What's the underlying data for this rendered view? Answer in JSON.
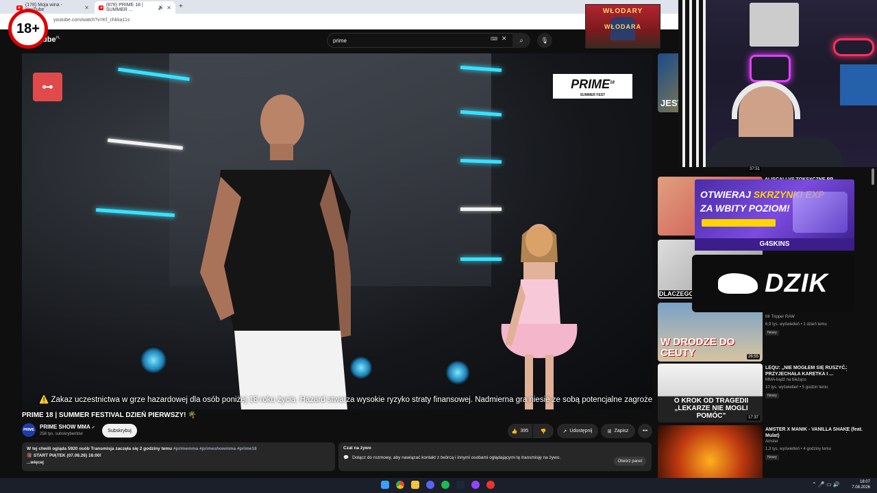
{
  "browser": {
    "tabs": [
      {
        "label": "(178) Moja wina - YouTube"
      },
      {
        "label": "(878) PRIME 18 | SUMMER ..."
      }
    ],
    "new_tab": "+",
    "url": "youtube.com/watch?v=Kf_chkka11s"
  },
  "overlay": {
    "age_badge": "18+",
    "banner_line1": "WŁODARY",
    "banner_line2": "WŁODARA"
  },
  "youtube": {
    "logo_suffix": "ube",
    "logo_region": "PL",
    "search_value": "prime"
  },
  "video": {
    "logo_text": "PRIME",
    "logo_sup": "18",
    "logo_sub": "SUMMER FEST",
    "warning": "⚠️ Zakaz uczestnictwa w grze hazardowej dla osób poniżej 18 roku życia. Hazard stwarza wysokie ryzyko straty finansowej. Nadmierna gra niesie ze sobą potencjalne zagrożenie dla zdrowia ⚠️",
    "title": "PRIME 18 | SUMMER FESTIVAL DZIEŃ PIERWSZY! 🌴",
    "channel": "PRIME SHOW MMA",
    "subscribers": "258 tys. subskrybentów",
    "subscribe_label": "Subskrybuj",
    "likes": "395",
    "share_label": "Udostępnij",
    "save_label": "Zapisz",
    "more_label": "•••"
  },
  "description": {
    "line1": "W tej chwili ogląda 5920 osób  Transmisja zaczęła się 2 godziny temu",
    "tags": "#primemma #primeshowmma #prime18",
    "line2": "🔞 START PIĄTEK (07.08.26) 16:00!",
    "more": "...więcej"
  },
  "chat": {
    "title": "Czat na żywo",
    "text": "Dołącz do rozmowy, aby nawiązać kontakt z twórcą i innymi osobami oglądającymi tę transmisję na żywo.",
    "button": "Otwórz panel"
  },
  "recommendations": [
    {
      "title": "",
      "channel": "",
      "meta": "",
      "duration": "",
      "thumb": "JEST GORZEJ"
    },
    {
      "title": "ALISCALI VS TOKSYCZNE RP",
      "channel": "",
      "meta": "",
      "duration": "37:51",
      "thumb": ""
    },
    {
      "title": "",
      "channel": "",
      "meta": "",
      "duration": "",
      "thumb": "DLACZEGO"
    },
    {
      "title": "",
      "channel": "Mr Tripper RAW",
      "meta": "6,9 tys. wyświetleń • 1 dzień temu",
      "badge": "Nowy",
      "duration": "26:55",
      "thumb": "W DRODZE DO CEUTY"
    },
    {
      "title": "LEQU: „NIE MOGŁEM SIĘ RUSZYĆ. PRZYJECHAŁA KARETKA I ...",
      "channel": "MMA-bądź na bieżąco",
      "meta": "10 tys. wyświetleń • 5 godzin temu",
      "badge": "Nowy",
      "duration": "17:37",
      "thumb": "O KROK OD TRAGEDII „LEKARZE NIE MOGLI POMÓC”"
    },
    {
      "title": "AMSTER X MANIK - VANILLA SHAKE (feat. Mulat)",
      "channel": "Amster",
      "meta": "1,3 tys. wyświetleń • 4 godziny temu",
      "badge": "Nowy",
      "duration": "",
      "thumb": ""
    }
  ],
  "ads": {
    "ad1_line1a": "OTWIERAJ ",
    "ad1_line1b": "SKRZYNKI EXP",
    "ad1_line2": "ZA WBITY POZIOM!",
    "ad1_brand": "G4SKINS",
    "ad2_brand": "DZIK"
  },
  "taskbar": {
    "time": "18:07",
    "date": "7.08.2026"
  }
}
